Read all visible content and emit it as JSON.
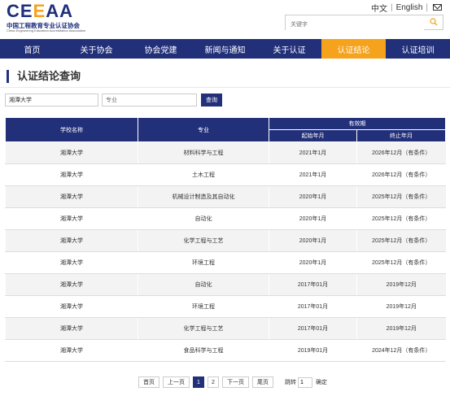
{
  "logo": {
    "mark_main": "CE",
    "mark_accent": "E",
    "mark_tail": "AA",
    "cn_name": "中国工程教育专业认证协会",
    "en_name": "China Engineering Education Accreditation Association"
  },
  "lang": {
    "zh": "中文",
    "en": "English"
  },
  "search": {
    "placeholder": "关键字"
  },
  "nav": {
    "items": [
      {
        "label": "首页"
      },
      {
        "label": "关于协会"
      },
      {
        "label": "协会党建"
      },
      {
        "label": "新闻与通知"
      },
      {
        "label": "关于认证"
      },
      {
        "label": "认证结论"
      },
      {
        "label": "认证培训"
      }
    ]
  },
  "page": {
    "title": "认证结论查询"
  },
  "filters": {
    "school_value": "湘潭大学",
    "major_placeholder": "专业",
    "query_label": "查询"
  },
  "table": {
    "headers": {
      "school": "学校名称",
      "major": "专业",
      "validity": "有效期",
      "start": "起始年月",
      "end": "终止年月"
    },
    "rows": [
      {
        "school": "湘潭大学",
        "major": "材料科学与工程",
        "start": "2021年1月",
        "end": "2026年12月（有条件）"
      },
      {
        "school": "湘潭大学",
        "major": "土木工程",
        "start": "2021年1月",
        "end": "2026年12月（有条件）"
      },
      {
        "school": "湘潭大学",
        "major": "机械设计制造及其自动化",
        "start": "2020年1月",
        "end": "2025年12月（有条件）"
      },
      {
        "school": "湘潭大学",
        "major": "自动化",
        "start": "2020年1月",
        "end": "2025年12月（有条件）"
      },
      {
        "school": "湘潭大学",
        "major": "化学工程与工艺",
        "start": "2020年1月",
        "end": "2025年12月（有条件）"
      },
      {
        "school": "湘潭大学",
        "major": "环境工程",
        "start": "2020年1月",
        "end": "2025年12月（有条件）"
      },
      {
        "school": "湘潭大学",
        "major": "自动化",
        "start": "2017年01月",
        "end": "2019年12月"
      },
      {
        "school": "湘潭大学",
        "major": "环境工程",
        "start": "2017年01月",
        "end": "2019年12月"
      },
      {
        "school": "湘潭大学",
        "major": "化学工程与工艺",
        "start": "2017年01月",
        "end": "2019年12月"
      },
      {
        "school": "湘潭大学",
        "major": "食品科学与工程",
        "start": "2019年01月",
        "end": "2024年12月（有条件）"
      }
    ]
  },
  "pagination": {
    "first": "首页",
    "prev": "上一页",
    "pages": [
      "1",
      "2"
    ],
    "current": "1",
    "next": "下一页",
    "last": "尾页",
    "jump_label": "跳转",
    "jump_value": "1",
    "jump_btn": "确定"
  },
  "colors": {
    "brand_navy": "#22307a",
    "accent_orange": "#f5a21c"
  }
}
